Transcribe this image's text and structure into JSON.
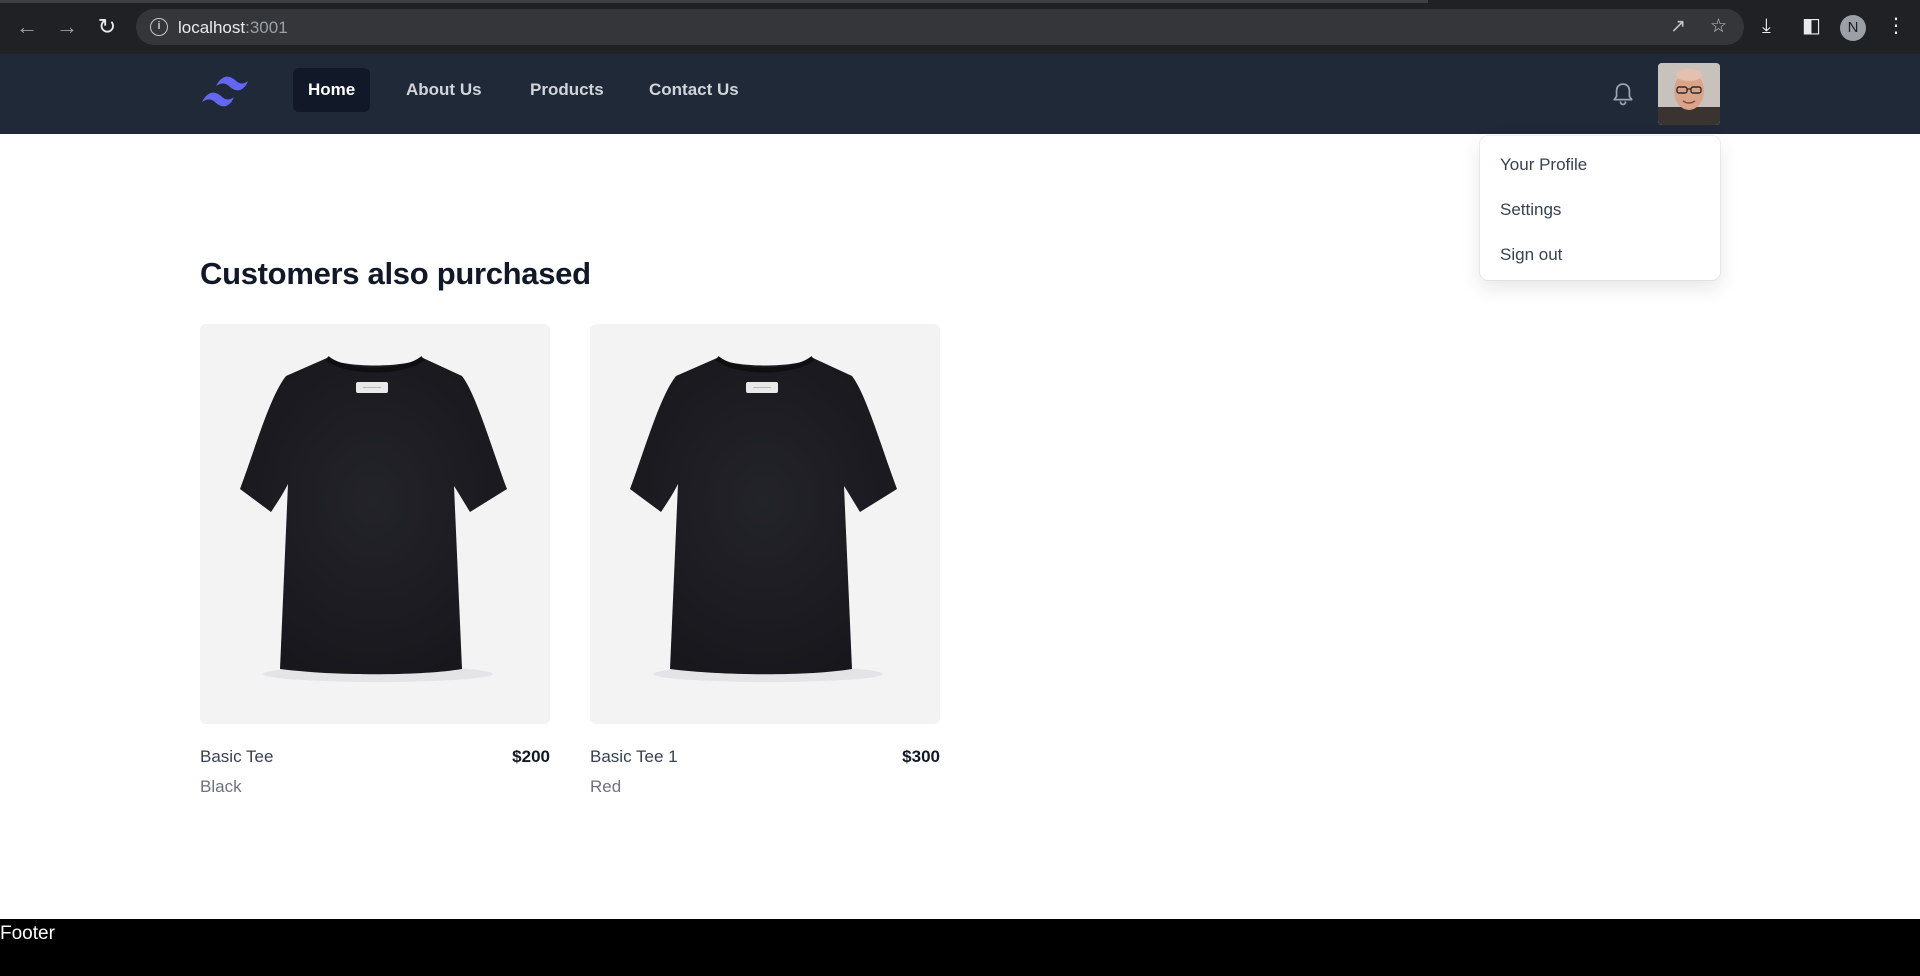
{
  "browser": {
    "url_host": "localhost",
    "url_port": ":3001",
    "profile_initial": "N"
  },
  "nav": {
    "items": [
      {
        "label": "Home",
        "current": true
      },
      {
        "label": "About Us",
        "current": false
      },
      {
        "label": "Products",
        "current": false
      },
      {
        "label": "Contact Us",
        "current": false
      }
    ]
  },
  "user_menu": {
    "items": [
      "Your Profile",
      "Settings",
      "Sign out"
    ]
  },
  "main": {
    "heading": "Customers also purchased",
    "products": [
      {
        "name": "Basic Tee",
        "price": "$200",
        "color": "Black"
      },
      {
        "name": "Basic Tee 1",
        "price": "$300",
        "color": "Red"
      }
    ]
  },
  "footer": {
    "text": "Footer"
  },
  "colors": {
    "appbar": "#1f2937",
    "nav_current": "#111827",
    "logo": "#6366f1"
  },
  "icons": [
    "back-arrow-icon",
    "forward-arrow-icon",
    "reload-icon",
    "info-icon",
    "share-icon",
    "star-icon",
    "download-icon",
    "sidepanel-icon",
    "more-vert-icon",
    "bell-icon",
    "tailwind-logo"
  ]
}
